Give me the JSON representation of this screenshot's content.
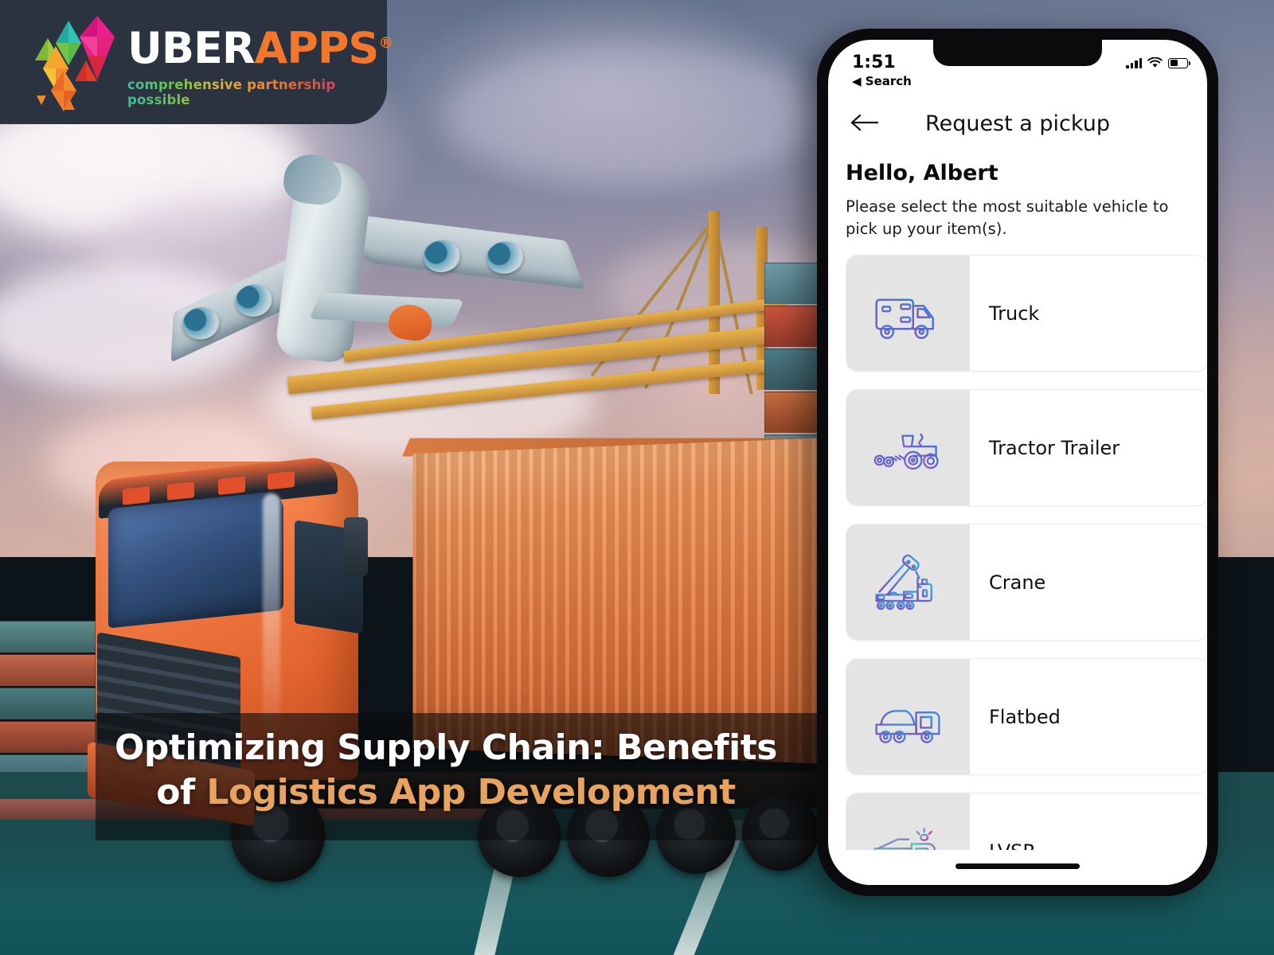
{
  "brand": {
    "name_primary": "UBER",
    "name_secondary": "APPS",
    "registered_mark": "®",
    "tagline": "comprehensive partnership possible",
    "logo_icon": "uberapps-triangles-logo"
  },
  "banner": {
    "title_line1": "Optimizing Supply Chain: Benefits",
    "title_line2_plain": "of ",
    "title_line2_accent": "Logistics App Development",
    "accent_color": "#e7a35f",
    "overlay_color": "rgba(8,10,12,0.60)"
  },
  "photo": {
    "description": "Orange semi truck with shipping container at a port, airplane overhead, gantry crane and stacked containers",
    "elements": [
      "airplane",
      "orange-truck",
      "shipping-container",
      "gantry-crane",
      "container-stacks",
      "road"
    ]
  },
  "phone": {
    "status_bar": {
      "time": "1:51",
      "back_label": "Search",
      "back_icon": "triangle-left-icon",
      "signal_icon": "cellular-signal-icon",
      "wifi_icon": "wifi-icon",
      "battery_icon": "battery-icon"
    },
    "nav": {
      "back_icon": "arrow-left-icon",
      "title": "Request a pickup"
    },
    "content": {
      "greeting": "Hello, Albert",
      "instruction": "Please select the most suitable vehicle to pick up your item(s)."
    },
    "vehicles": [
      {
        "label": "Truck",
        "icon": "truck-icon",
        "gradient_from": "#7b5bc4",
        "gradient_to": "#3f7fd4"
      },
      {
        "label": "Tractor Trailer",
        "icon": "tractor-trailer-icon",
        "gradient_from": "#8b5fc9",
        "gradient_to": "#3f6fd0"
      },
      {
        "label": "Crane",
        "icon": "crane-icon",
        "gradient_from": "#7a52b8",
        "gradient_to": "#3fa8df"
      },
      {
        "label": "Flatbed",
        "icon": "flatbed-icon",
        "gradient_from": "#7a52b8",
        "gradient_to": "#3f93de"
      },
      {
        "label": "LVSR",
        "icon": "lvsr-icon",
        "gradient_from": "#4fc5c8",
        "gradient_to": "#cf39a8"
      }
    ],
    "home_indicator": "home-indicator"
  }
}
